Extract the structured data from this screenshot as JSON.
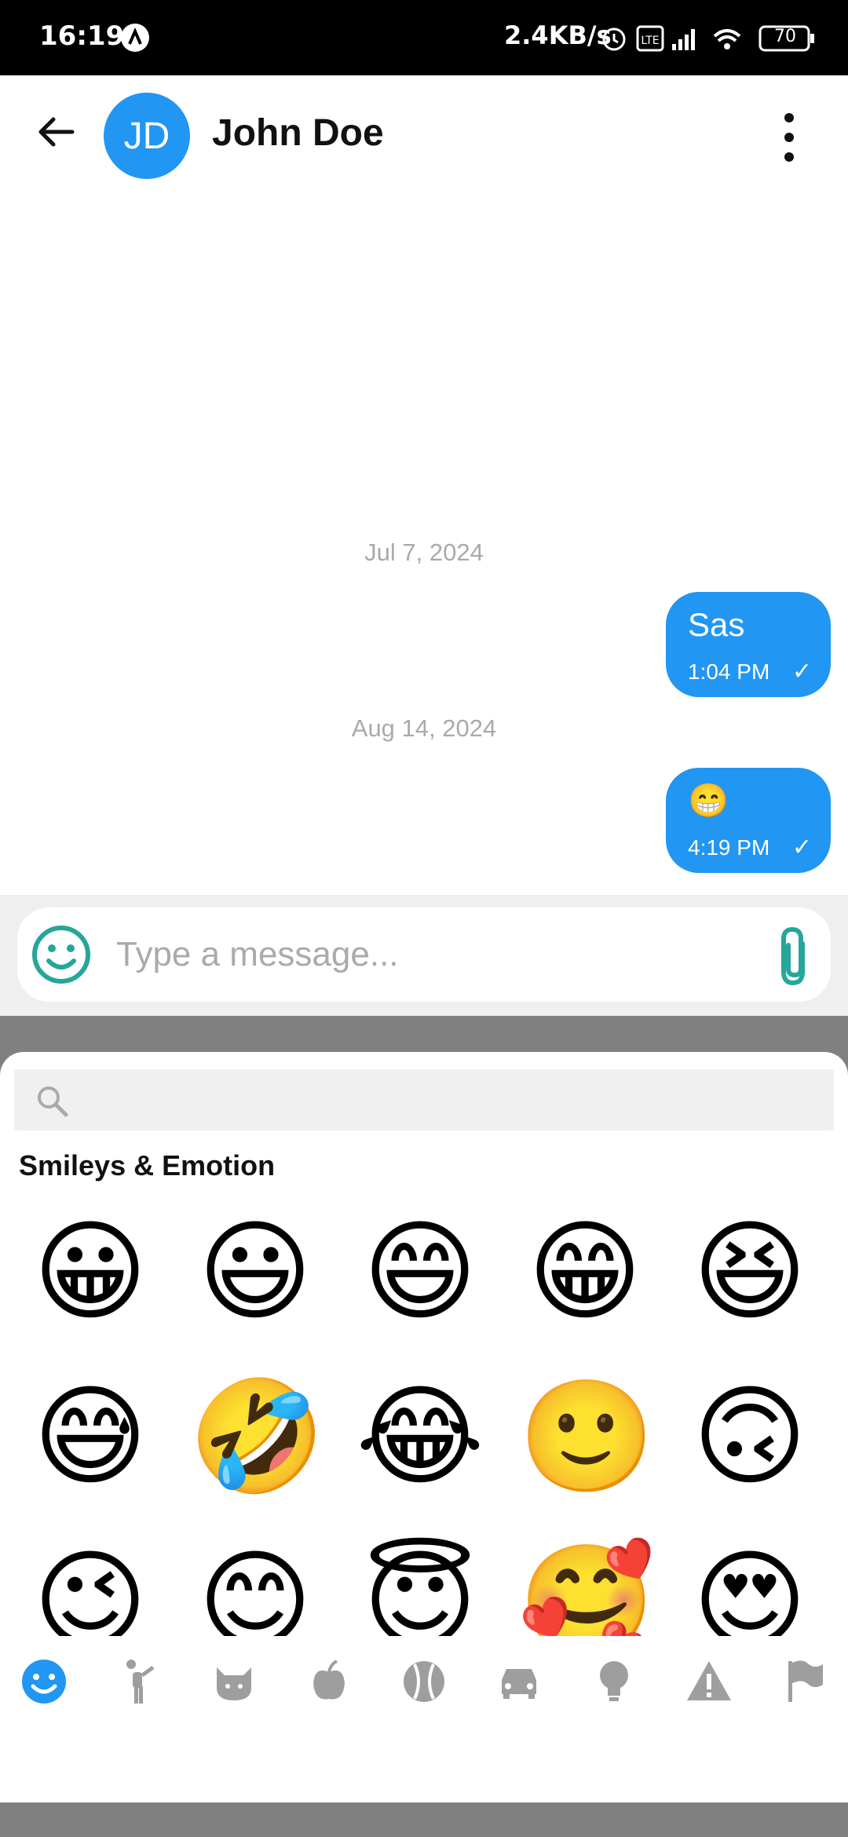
{
  "status_bar": {
    "time": "16:19",
    "speed": "2.4KB/s",
    "battery": "70"
  },
  "header": {
    "avatar_initials": "JD",
    "contact_name": "John Doe"
  },
  "messages": [
    {
      "date": "Jul 7, 2024",
      "text": "Sas",
      "time": "1:04 PM",
      "status": "✓"
    },
    {
      "date": "Aug 14, 2024",
      "text": "😁",
      "time": "4:19 PM",
      "status": "✓"
    }
  ],
  "composer": {
    "placeholder": "Type a message..."
  },
  "emoji_picker": {
    "search_placeholder": "",
    "section_title": "Smileys & Emotion",
    "emojis": [
      "😀",
      "😃",
      "😄",
      "😁",
      "😆",
      "😅",
      "🤣",
      "😂",
      "🙂",
      "🙃",
      "😉",
      "😊",
      "😇",
      "🥰",
      "😍"
    ],
    "categories": [
      "smileys-icon",
      "people-icon",
      "animals-icon",
      "food-icon",
      "activity-icon",
      "travel-icon",
      "objects-icon",
      "symbols-icon",
      "flags-icon"
    ],
    "active_category": "smileys-icon"
  },
  "colors": {
    "accent": "#2196F3",
    "emoji_button": "#26A69A",
    "category_inactive": "#9E9E9E"
  }
}
